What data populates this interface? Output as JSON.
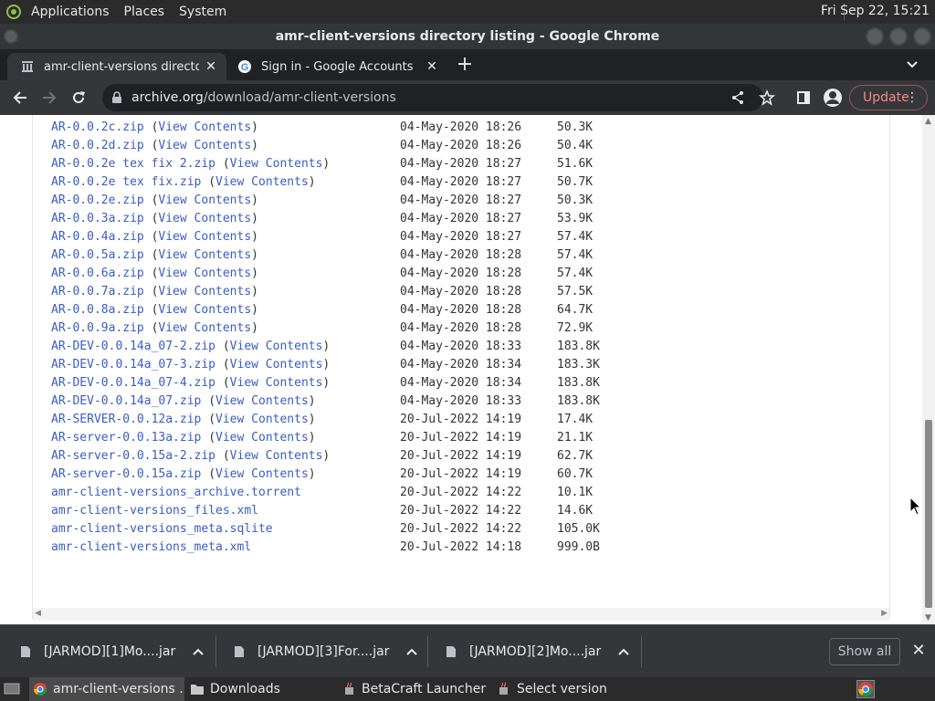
{
  "system_bar": {
    "menus": [
      "Applications",
      "Places",
      "System"
    ],
    "clock": "Fri Sep 22, 15:21"
  },
  "window": {
    "title": "amr-client-versions directory listing - Google Chrome"
  },
  "tabs": [
    {
      "title": "amr-client-versions directory l",
      "active": true
    },
    {
      "title": "Sign in - Google Accounts",
      "active": false
    }
  ],
  "toolbar": {
    "url_host": "archive.org",
    "url_path": "/download/amr-client-versions",
    "update_label": "Update"
  },
  "listing": [
    {
      "name": "AR-0.0.2c.zip",
      "view": "View Contents",
      "date": "04-May-2020 18:26",
      "size": "50.3K"
    },
    {
      "name": "AR-0.0.2d.zip",
      "view": "View Contents",
      "date": "04-May-2020 18:26",
      "size": "50.4K"
    },
    {
      "name": "AR-0.0.2e tex fix 2.zip",
      "view": "View Contents",
      "date": "04-May-2020 18:27",
      "size": "51.6K"
    },
    {
      "name": "AR-0.0.2e tex fix.zip",
      "view": "View Contents",
      "date": "04-May-2020 18:27",
      "size": "50.7K"
    },
    {
      "name": "AR-0.0.2e.zip",
      "view": "View Contents",
      "date": "04-May-2020 18:27",
      "size": "50.3K"
    },
    {
      "name": "AR-0.0.3a.zip",
      "view": "View Contents",
      "date": "04-May-2020 18:27",
      "size": "53.9K"
    },
    {
      "name": "AR-0.0.4a.zip",
      "view": "View Contents",
      "date": "04-May-2020 18:27",
      "size": "57.4K"
    },
    {
      "name": "AR-0.0.5a.zip",
      "view": "View Contents",
      "date": "04-May-2020 18:28",
      "size": "57.4K"
    },
    {
      "name": "AR-0.0.6a.zip",
      "view": "View Contents",
      "date": "04-May-2020 18:28",
      "size": "57.4K"
    },
    {
      "name": "AR-0.0.7a.zip",
      "view": "View Contents",
      "date": "04-May-2020 18:28",
      "size": "57.5K"
    },
    {
      "name": "AR-0.0.8a.zip",
      "view": "View Contents",
      "date": "04-May-2020 18:28",
      "size": "64.7K"
    },
    {
      "name": "AR-0.0.9a.zip",
      "view": "View Contents",
      "date": "04-May-2020 18:28",
      "size": "72.9K"
    },
    {
      "name": "AR-DEV-0.0.14a_07-2.zip",
      "view": "View Contents",
      "date": "04-May-2020 18:33",
      "size": "183.8K"
    },
    {
      "name": "AR-DEV-0.0.14a_07-3.zip",
      "view": "View Contents",
      "date": "04-May-2020 18:34",
      "size": "183.3K"
    },
    {
      "name": "AR-DEV-0.0.14a_07-4.zip",
      "view": "View Contents",
      "date": "04-May-2020 18:34",
      "size": "183.8K"
    },
    {
      "name": "AR-DEV-0.0.14a_07.zip",
      "view": "View Contents",
      "date": "04-May-2020 18:33",
      "size": "183.8K"
    },
    {
      "name": "AR-SERVER-0.0.12a.zip",
      "view": "View Contents",
      "date": "20-Jul-2022 14:19",
      "size": "17.4K"
    },
    {
      "name": "AR-server-0.0.13a.zip",
      "view": "View Contents",
      "date": "20-Jul-2022 14:19",
      "size": "21.1K"
    },
    {
      "name": "AR-server-0.0.15a-2.zip",
      "view": "View Contents",
      "date": "20-Jul-2022 14:19",
      "size": "62.7K"
    },
    {
      "name": "AR-server-0.0.15a.zip",
      "view": "View Contents",
      "date": "20-Jul-2022 14:19",
      "size": "60.7K"
    },
    {
      "name": "amr-client-versions_archive.torrent",
      "view": "",
      "date": "20-Jul-2022 14:22",
      "size": "10.1K"
    },
    {
      "name": "amr-client-versions_files.xml",
      "view": "",
      "date": "20-Jul-2022 14:22",
      "size": "14.6K"
    },
    {
      "name": "amr-client-versions_meta.sqlite",
      "view": "",
      "date": "20-Jul-2022 14:22",
      "size": "105.0K"
    },
    {
      "name": "amr-client-versions_meta.xml",
      "view": "",
      "date": "20-Jul-2022 14:18",
      "size": "999.0B"
    }
  ],
  "downloads": {
    "items": [
      "[JARMOD][1]Mo....jar",
      "[JARMOD][3]For....jar",
      "[JARMOD][2]Mo....jar"
    ],
    "show_all_label": "Show all"
  },
  "taskbar": {
    "items": [
      {
        "label": "amr-client-versions ...",
        "icon": "chrome-icon",
        "active": true
      },
      {
        "label": "Downloads",
        "icon": "folder-icon",
        "active": false
      },
      {
        "label": "BetaCraft Launcher ...",
        "icon": "java-icon",
        "active": false
      },
      {
        "label": "Select version",
        "icon": "java-icon",
        "active": false
      }
    ]
  }
}
